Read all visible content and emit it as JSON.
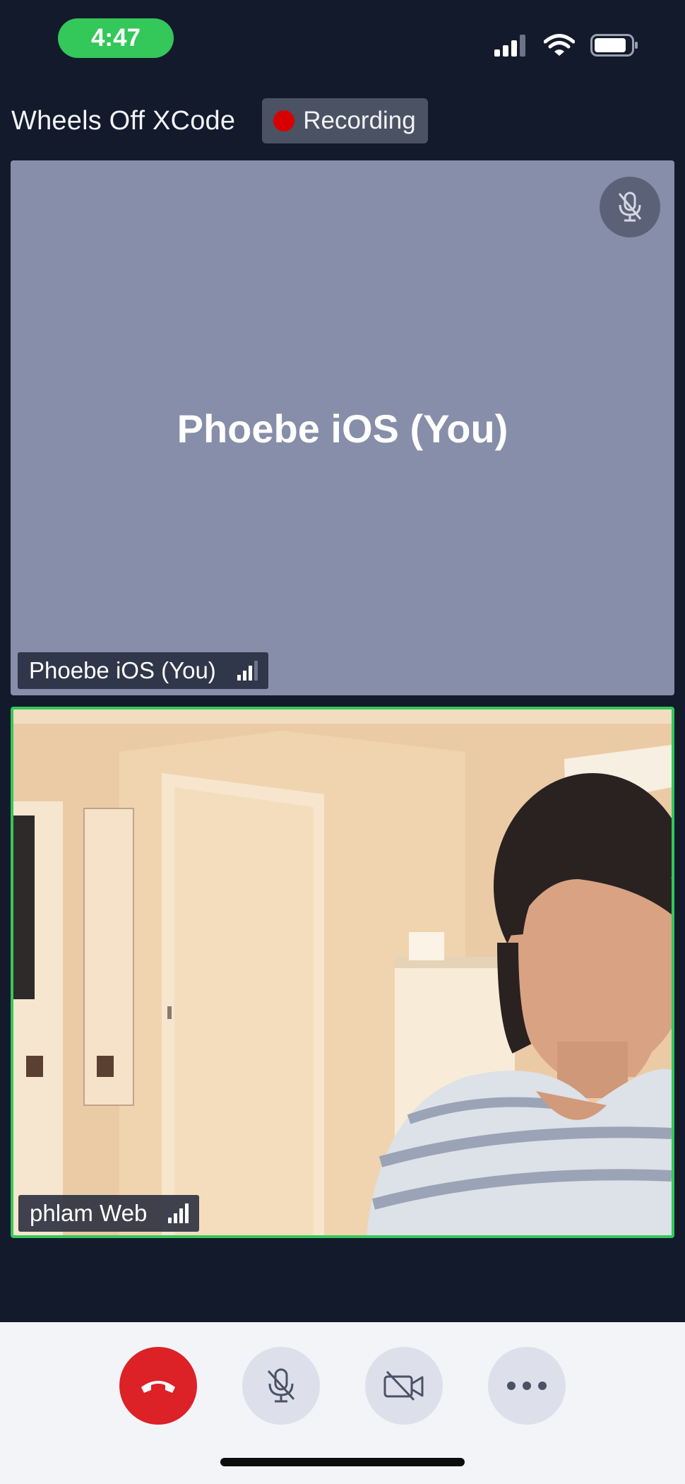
{
  "status_bar": {
    "time": "4:47",
    "icons": [
      "cellular-signal-icon",
      "wifi-icon",
      "battery-icon"
    ]
  },
  "header": {
    "call_title": "Wheels Off XCode",
    "recording_label": "Recording"
  },
  "participants": [
    {
      "name": "Phoebe iOS (You)",
      "tile_center_label": "Phoebe iOS (You)",
      "video": "off",
      "muted": true,
      "connection_icon": "network-quality-icon"
    },
    {
      "name": "phlam Web",
      "video": "on",
      "active_speaker": true,
      "connection_icon": "network-quality-icon"
    }
  ],
  "controls": {
    "buttons": [
      "end-call-icon",
      "microphone-muted-icon",
      "camera-off-icon",
      "more-options-icon"
    ]
  },
  "colors": {
    "background": "#121a2c",
    "self_tile": "#878ea9",
    "active_speaker_border": "#34c759",
    "recording_dot": "#d70000",
    "end_call": "#dc2127",
    "control_bar": "#f3f4f8"
  }
}
